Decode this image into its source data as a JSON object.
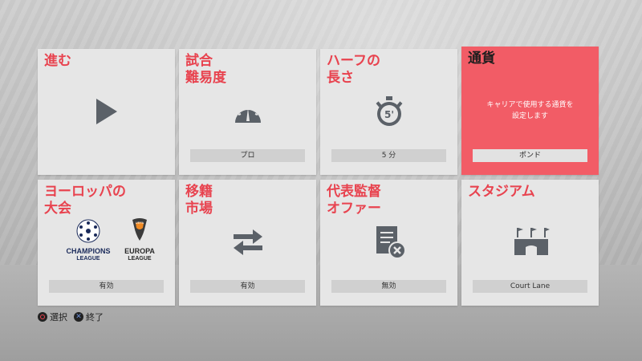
{
  "tiles": [
    {
      "id": "proceed",
      "title": "進む",
      "value": null,
      "icon": "play-icon"
    },
    {
      "id": "difficulty",
      "title": "試合\n難易度",
      "value": "プロ",
      "icon": "speedometer-icon"
    },
    {
      "id": "half_length",
      "title": "ハーフの\n長さ",
      "value": "5 分",
      "icon": "stopwatch-icon",
      "icon_text": "5'"
    },
    {
      "id": "currency",
      "title": "通貨",
      "value": "ポンド",
      "description": "キャリアで使用する通貨を\n設定します",
      "selected": true
    },
    {
      "id": "european_cups",
      "title": "ヨーロッパの\n大会",
      "value": "有効",
      "icon": "uefa-logos",
      "logos": {
        "ucl_top": "UEFA",
        "ucl_name": "CHAMPIONS",
        "ucl_sub": "LEAGUE",
        "uel_top": "UEFA",
        "uel_name": "EUROPA",
        "uel_sub": "LEAGUE"
      }
    },
    {
      "id": "transfer_market",
      "title": "移籍\n市場",
      "value": "有効",
      "icon": "transfer-arrows-icon"
    },
    {
      "id": "international_offers",
      "title": "代表監督\nオファー",
      "value": "無効",
      "icon": "document-cancel-icon"
    },
    {
      "id": "stadium",
      "title": "スタジアム",
      "value": "Court Lane",
      "icon": "stadium-icon"
    }
  ],
  "hints": [
    {
      "label": "選択",
      "button": "circle"
    },
    {
      "label": "終了",
      "button": "cross"
    }
  ],
  "colors": {
    "accent": "#e8434f",
    "selected_bg": "#f25c66",
    "tile_bg": "#e6e6e6",
    "icon": "#5b6168"
  }
}
